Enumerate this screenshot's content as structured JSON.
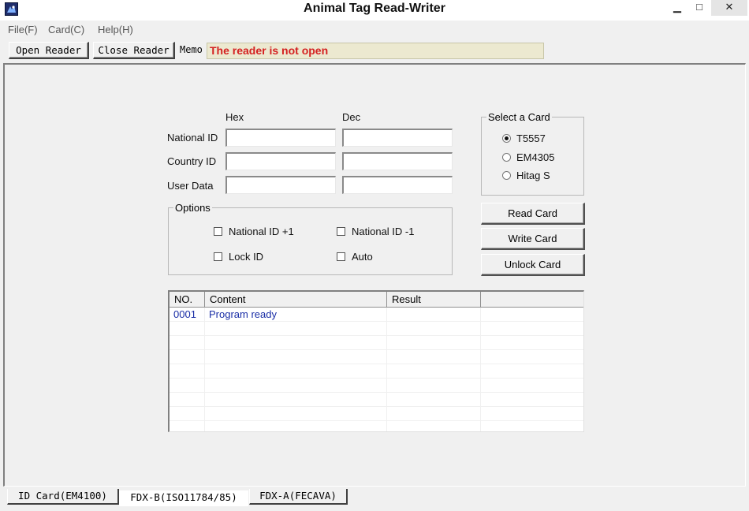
{
  "window": {
    "title": "Animal Tag Read-Writer",
    "app_icon": "animal-tag-app-icon",
    "controls": {
      "minimize": "▁",
      "maximize": "□",
      "close": "✕"
    }
  },
  "menu": [
    {
      "label": "File(F)"
    },
    {
      "label": "Card(C)"
    },
    {
      "label": "Help(H)"
    }
  ],
  "toolbar": {
    "open_label": "Open Reader",
    "close_label": "Close Reader",
    "memo_label": "Memo",
    "memo_text": "The reader is not open",
    "memo_color": "#d42020"
  },
  "form": {
    "hex_header": "Hex",
    "dec_header": "Dec",
    "rows": [
      {
        "label": "National ID",
        "hex": "",
        "dec": ""
      },
      {
        "label": "Country ID",
        "hex": "",
        "dec": ""
      },
      {
        "label": "User Data",
        "hex": "",
        "dec": ""
      }
    ]
  },
  "options": {
    "title": "Options",
    "items": [
      {
        "label": "National ID +1",
        "checked": false
      },
      {
        "label": "National ID -1",
        "checked": false
      },
      {
        "label": "Lock ID",
        "checked": false
      },
      {
        "label": "Auto",
        "checked": false
      }
    ]
  },
  "card_select": {
    "title": "Select a Card",
    "options": [
      {
        "label": "T5557",
        "selected": true
      },
      {
        "label": "EM4305",
        "selected": false
      },
      {
        "label": "Hitag S",
        "selected": false
      }
    ]
  },
  "actions": {
    "read": "Read Card",
    "write": "Write Card",
    "unlock": "Unlock Card"
  },
  "log": {
    "columns": [
      "NO.",
      "Content",
      "Result",
      ""
    ],
    "rows": [
      {
        "no": "0001",
        "content": "Program ready",
        "result": ""
      }
    ],
    "text_color": "#1a2ea6"
  },
  "tabs": [
    {
      "label": "ID Card(EM4100)",
      "active": false
    },
    {
      "label": "FDX-B(ISO11784/85)",
      "active": true
    },
    {
      "label": "FDX-A(FECAVA)",
      "active": false
    }
  ]
}
